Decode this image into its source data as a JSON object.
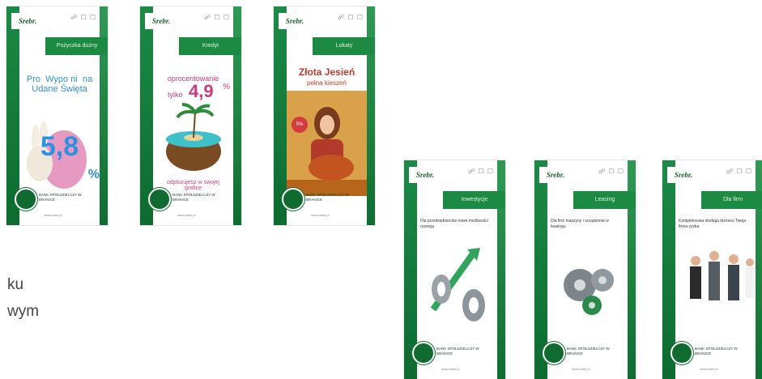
{
  "posters": [
    {
      "brand": "Srebr.",
      "icons": "☍ ☐ ☐",
      "tab": "Pożyczka dużny",
      "headline": "Pro  Wypo ni  na Udane Święta",
      "big": "5,8",
      "pct": "%",
      "bank": "BANK SPÓŁDZIELCZY W BRANICE",
      "url": "www.bank.pl"
    },
    {
      "brand": "Srebr.",
      "icons": "☍ ☐ ☐",
      "tab": "Kredyt",
      "headline": "oprocentowanie",
      "tylko": "tylko",
      "big": "4,9",
      "pct": "%",
      "sub": "odpiszujesz w swojej grafice",
      "bank": "BANK SPÓŁDZIELCZY W BRANICE",
      "url": "www.bank.pl"
    },
    {
      "brand": "Srebr.",
      "icons": "☍ ☐ ☐",
      "tab": "Lokaty",
      "headline": "Złota Jesień",
      "sub": "pełna kieszeń",
      "badge": "5%",
      "bank": "BANK SPÓŁDZIELCZY W BRANICE",
      "url": "www.bank.pl"
    },
    {
      "brand": "Srebr.",
      "icons": "☍ ☐ ☐",
      "tab": "Inwestycje",
      "lines": "Dla przedsiębiorców nowe możliwości rozwoju",
      "bank": "BANK SPÓŁDZIELCZY W BRANICE",
      "url": "www.bank.pl"
    },
    {
      "brand": "Srebr.",
      "icons": "☍ ☐ ☐",
      "tab": "Leasing",
      "lines": "Dla firm maszyny i urządzenia w leasingu",
      "bank": "BANK SPÓŁDZIELCZY W BRANICE",
      "url": "www.bank.pl"
    },
    {
      "brand": "Srebr.",
      "icons": "☍ ☐ ☐",
      "tab": "Dla firm",
      "lines": "Kompleksowa obsługa biznesu Twoja firma zyska",
      "bank": "BANK SPÓŁDZIELCZY W BRANICE",
      "url": "www.bank.pl"
    }
  ],
  "side_text": {
    "line1": "ku",
    "line2": "wym"
  }
}
